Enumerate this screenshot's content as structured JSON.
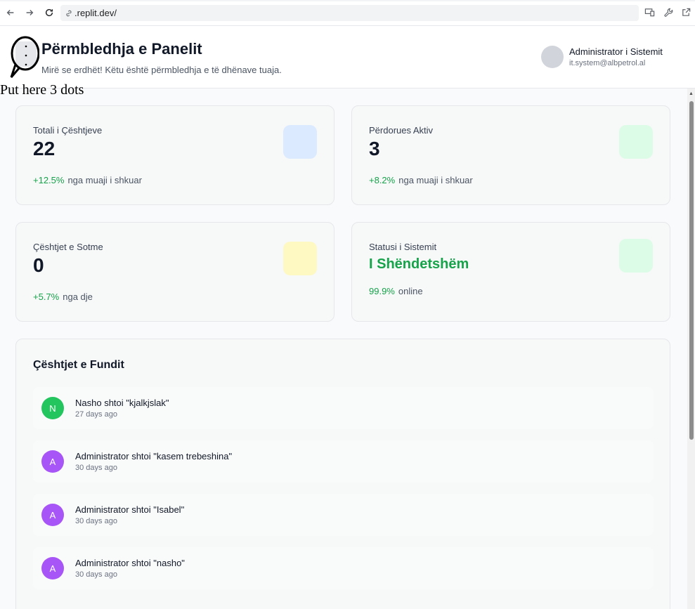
{
  "browser": {
    "url": ".replit.dev/"
  },
  "header": {
    "title": "Përmbledhja e Panelit",
    "subtitle": "Mirë se erdhët! Këtu është përmbledhja e të dhënave tuaja.",
    "user_name": "Administrator i Sistemit",
    "user_email": "it.system@albpetrol.al"
  },
  "annotation": {
    "text": "Put here 3 dots"
  },
  "stats": [
    {
      "label": "Totali i Çështjeve",
      "value": "22",
      "change": "+12.5%",
      "change_text": "nga muaji i shkuar",
      "icon_color": "#dbeafe"
    },
    {
      "label": "Përdorues Aktiv",
      "value": "3",
      "change": "+8.2%",
      "change_text": "nga muaji i shkuar",
      "icon_color": "#dcfce7"
    },
    {
      "label": "Çështjet e Sotme",
      "value": "0",
      "change": "+5.7%",
      "change_text": "nga dje",
      "icon_color": "#fef9c3"
    },
    {
      "label": "Statusi i Sistemit",
      "value": "I Shëndetshëm",
      "change": "99.9%",
      "change_text": "online",
      "icon_color": "#dcfce7"
    }
  ],
  "activity": {
    "title": "Çështjet e Fundit",
    "items": [
      {
        "initial": "N",
        "color": "#22c55e",
        "text": "Nasho shtoi \"kjalkjslak\"",
        "time": "27 days ago"
      },
      {
        "initial": "A",
        "color": "#a855f7",
        "text": "Administrator shtoi \"kasem trebeshina\"",
        "time": "30 days ago"
      },
      {
        "initial": "A",
        "color": "#a855f7",
        "text": "Administrator shtoi \"Isabel\"",
        "time": "30 days ago"
      },
      {
        "initial": "A",
        "color": "#a855f7",
        "text": "Administrator shtoi \"nasho\"",
        "time": "30 days ago"
      }
    ]
  }
}
